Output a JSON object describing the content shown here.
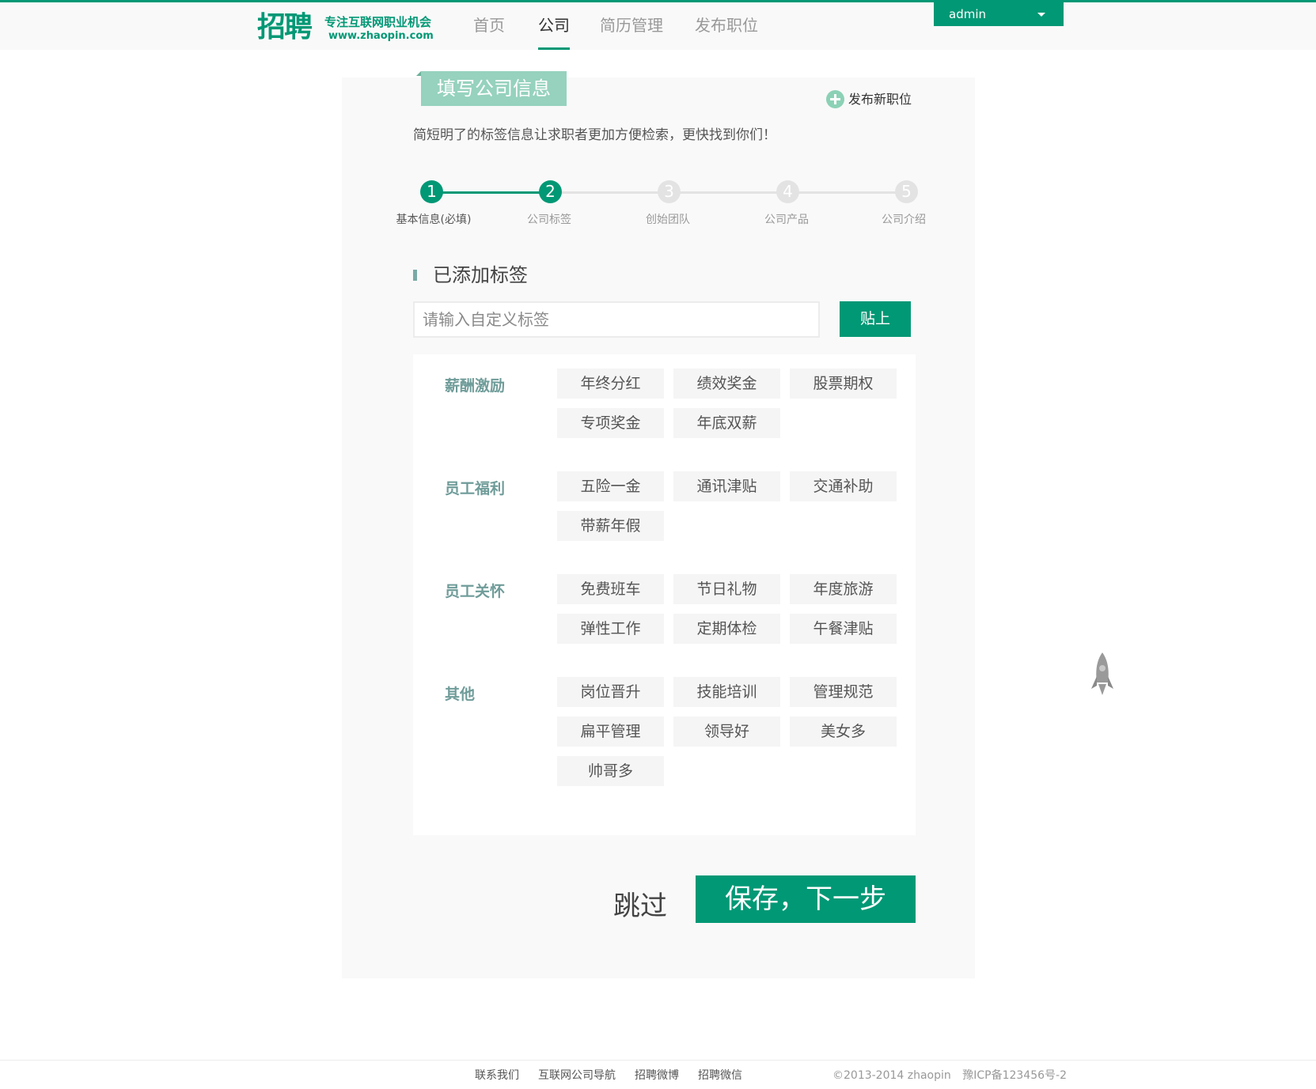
{
  "header": {
    "logo_mark": "招聘",
    "logo_slogan": "专注互联网职业机会",
    "logo_url": "www.zhaopin.com",
    "nav": [
      "首页",
      "公司",
      "简历管理",
      "发布职位"
    ],
    "active_nav": "公司",
    "user": "admin",
    "accent_color": "#019875"
  },
  "card": {
    "title": "填写公司信息",
    "publish_link": "发布新职位",
    "subtitle": "简短明了的标签信息让求职者更加方便检索，更快找到你们！"
  },
  "steps": [
    {
      "num": "1",
      "label": "基本信息(必填)",
      "state": "done"
    },
    {
      "num": "2",
      "label": "公司标签",
      "state": "current"
    },
    {
      "num": "3",
      "label": "创始团队",
      "state": "todo"
    },
    {
      "num": "4",
      "label": "公司产品",
      "state": "todo"
    },
    {
      "num": "5",
      "label": "公司介绍",
      "state": "todo"
    }
  ],
  "tags_section": {
    "title": "已添加标签",
    "input_placeholder": "请输入自定义标签",
    "paste_label": "贴上",
    "groups": [
      {
        "name": "薪酬激励",
        "tags": [
          "年终分红",
          "绩效奖金",
          "股票期权",
          "专项奖金",
          "年底双薪"
        ]
      },
      {
        "name": "员工福利",
        "tags": [
          "五险一金",
          "通讯津贴",
          "交通补助",
          "带薪年假"
        ]
      },
      {
        "name": "员工关怀",
        "tags": [
          "免费班车",
          "节日礼物",
          "年度旅游",
          "弹性工作",
          "定期体检",
          "午餐津贴"
        ]
      },
      {
        "name": "其他",
        "tags": [
          "岗位晋升",
          "技能培训",
          "管理规范",
          "扁平管理",
          "领导好",
          "美女多",
          "帅哥多"
        ]
      }
    ]
  },
  "actions": {
    "skip": "跳过",
    "save": "保存，下一步"
  },
  "footer": {
    "links": [
      "联系我们",
      "互联网公司导航",
      "招聘微博",
      "招聘微信"
    ],
    "copyright": "©2013-2014 zhaopin",
    "icp": "豫ICP备123456号-2"
  }
}
